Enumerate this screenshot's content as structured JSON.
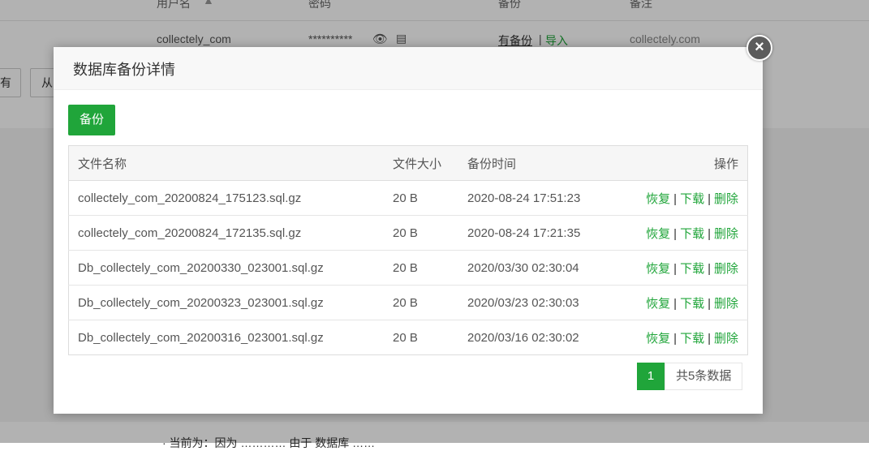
{
  "background": {
    "headers": [
      "用户名",
      "密码",
      "备份",
      "备注"
    ],
    "row": {
      "username": "collectely_com",
      "password": "**********",
      "backup_link": "有备份",
      "separator": "|",
      "import_link": "导入",
      "note": "collectely.com"
    },
    "buttons": [
      "有",
      "从"
    ],
    "bottom_text": "· 当前为：因为 ………… 由于 数据库 ……"
  },
  "modal": {
    "title": "数据库备份详情",
    "close_label": "×",
    "backup_button": "备份",
    "table": {
      "headers": {
        "name": "文件名称",
        "size": "文件大小",
        "time": "备份时间",
        "ops": "操作"
      },
      "rows": [
        {
          "name": "collectely_com_20200824_175123.sql.gz",
          "size": "20 B",
          "time": "2020-08-24 17:51:23"
        },
        {
          "name": "collectely_com_20200824_172135.sql.gz",
          "size": "20 B",
          "time": "2020-08-24 17:21:35"
        },
        {
          "name": "Db_collectely_com_20200330_023001.sql.gz",
          "size": "20 B",
          "time": "2020/03/30 02:30:04"
        },
        {
          "name": "Db_collectely_com_20200323_023001.sql.gz",
          "size": "20 B",
          "time": "2020/03/23 02:30:03"
        },
        {
          "name": "Db_collectely_com_20200316_023001.sql.gz",
          "size": "20 B",
          "time": "2020/03/16 02:30:02"
        }
      ],
      "actions": {
        "restore": "恢复",
        "download": "下载",
        "delete": "删除",
        "separator": "|"
      }
    },
    "pagination": {
      "current_page": "1",
      "total_text": "共5条数据"
    }
  },
  "colors": {
    "accent": "#20a53a",
    "close_button": "#5c5c5c"
  }
}
